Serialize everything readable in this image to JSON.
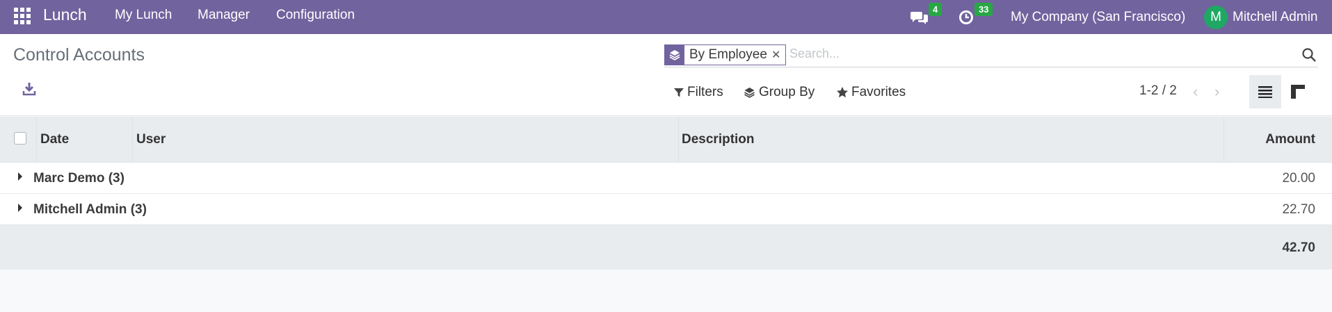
{
  "navbar": {
    "app_name": "Lunch",
    "menus": [
      "My Lunch",
      "Manager",
      "Configuration"
    ],
    "messages_count": "4",
    "activities_count": "33",
    "company": "My Company (San Francisco)",
    "avatar_initial": "M",
    "user_name": "Mitchell Admin",
    "color": "#71639e"
  },
  "control_panel": {
    "title": "Control Accounts",
    "facet_label": "By Employee",
    "search_placeholder": "Search...",
    "filters_label": "Filters",
    "groupby_label": "Group By",
    "favorites_label": "Favorites",
    "pager": "1-2 / 2"
  },
  "table": {
    "columns": [
      "Date",
      "User",
      "Description",
      "Amount"
    ],
    "groups": [
      {
        "name": "Marc Demo (3)",
        "amount": "20.00"
      },
      {
        "name": "Mitchell Admin (3)",
        "amount": "22.70"
      }
    ],
    "total": "42.70"
  }
}
